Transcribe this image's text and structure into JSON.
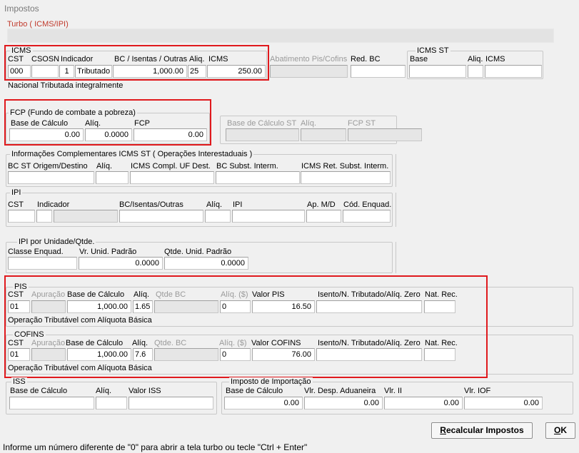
{
  "window": {
    "title": "Impostos"
  },
  "turbo": {
    "label": "Turbo ( ICMS/IPI)"
  },
  "icms": {
    "group_title": "ICMS",
    "labels": {
      "cst": "CST",
      "csosn": "CSOSN",
      "indicador": "Indicador",
      "bc": "BC / Isentas / Outras",
      "aliq": "Aliq.",
      "icms": "ICMS"
    },
    "values": {
      "cst": "000",
      "csosn": "",
      "ind_code": "1",
      "ind_text": "Tributado",
      "bc": "1,000.00",
      "aliq": "25",
      "icms": "250.00"
    },
    "description": "Nacional Tributada integralmente"
  },
  "abatimento": {
    "label": "Abatimento Pis/Cofins",
    "value": ""
  },
  "red_bc": {
    "label": "Red. BC",
    "value": ""
  },
  "icms_st": {
    "group_title": "ICMS ST",
    "labels": {
      "base": "Base",
      "aliq": "Aliq.",
      "icms": "ICMS"
    },
    "values": {
      "base": "",
      "aliq": "",
      "icms": ""
    }
  },
  "fcp": {
    "group_title": "FCP (Fundo de combate a pobreza)",
    "labels": {
      "base": "Base de Cálculo",
      "aliq": "Alíq.",
      "fcp": "FCP"
    },
    "values": {
      "base": "0.00",
      "aliq": "0.0000",
      "fcp": "0.00"
    }
  },
  "fcp_st": {
    "labels": {
      "base": "Base de Cálculo ST",
      "aliq": "Alíq.",
      "fcp": "FCP ST"
    },
    "values": {
      "base": "",
      "aliq": "",
      "fcp": ""
    }
  },
  "info_icms_st": {
    "group_title": "Informações Complementares ICMS ST ( Operações Interestaduais )",
    "labels": {
      "bc_origem": "BC ST Origem/Destino",
      "aliq": "Alíq.",
      "compl": "ICMS Compl. UF Dest.",
      "bc_subst": "BC  Subst. Interm.",
      "ret": "ICMS Ret. Subst. Interm."
    },
    "values": {
      "bc_origem": "",
      "aliq": "",
      "compl": "",
      "bc_subst": "",
      "ret": ""
    }
  },
  "ipi": {
    "group_title": "IPI",
    "labels": {
      "cst": "CST",
      "indicador": "Indicador",
      "bc": "BC/Isentas/Outras",
      "aliq": "Alíq.",
      "ipi": "IPI",
      "ap": "Ap. M/D",
      "cod": "Cód. Enquad."
    },
    "values": {
      "cst": "",
      "ind": "",
      "ind2": "",
      "bc": "",
      "aliq": "",
      "ipi": "",
      "ap": "",
      "cod": ""
    }
  },
  "ipi_unid": {
    "group_title": "IPI por Unidade/Qtde.",
    "labels": {
      "classe": "Classe Enquad.",
      "vr": "Vr. Unid. Padrão",
      "qtde": "Qtde. Unid. Padrão"
    },
    "values": {
      "classe": "",
      "vr": "0.0000",
      "qtde": "0.0000"
    }
  },
  "pis": {
    "group_title": "PIS",
    "labels": {
      "cst": "CST",
      "apuracao": "Apuração",
      "base": "Base de Cálculo",
      "aliq": "Alíq.",
      "qtde": "Qtde BC",
      "aliq_rs": "Alíq. ($)",
      "valor": "Valor PIS",
      "isento": "Isento/N. Tributado/Alíq. Zero",
      "nat": "Nat. Rec."
    },
    "values": {
      "cst": "01",
      "apuracao": "",
      "base": "1,000.00",
      "aliq": "1.65",
      "qtde": "",
      "aliq_rs": "0",
      "valor": "16.50",
      "isento": "",
      "nat": ""
    },
    "description": "Operação Tributável com Alíquota Básica"
  },
  "cofins": {
    "group_title": "COFINS",
    "labels": {
      "cst": "CST",
      "apuracao": "Apuração",
      "base": "Base de Cálculo",
      "aliq": "Alíq.",
      "qtde": "Qtde. BC",
      "aliq_rs": "Alíq. ($)",
      "valor": "Valor COFINS",
      "isento": "Isento/N. Tributado/Alíq. Zero",
      "nat": "Nat. Rec."
    },
    "values": {
      "cst": "01",
      "apuracao": "",
      "base": "1,000.00",
      "aliq": "7.6",
      "qtde": "",
      "aliq_rs": "0",
      "valor": "76.00",
      "isento": "",
      "nat": ""
    },
    "description": "Operação Tributável com Alíquota Básica"
  },
  "iss": {
    "group_title": "ISS",
    "labels": {
      "base": "Base de Cálculo",
      "aliq": "Alíq.",
      "valor": "Valor ISS"
    },
    "values": {
      "base": "",
      "aliq": "",
      "valor": ""
    }
  },
  "importacao": {
    "group_title": "Imposto de Importação",
    "labels": {
      "base": "Base de Cálculo",
      "desp": "Vlr. Desp. Aduaneira",
      "ii": "Vlr. II",
      "iof": "Vlr. IOF"
    },
    "values": {
      "base": "0.00",
      "desp": "0.00",
      "ii": "0.00",
      "iof": "0.00"
    }
  },
  "buttons": {
    "recalcular_first": "R",
    "recalcular_rest": "ecalcular Impostos",
    "ok_first": "O",
    "ok_rest": "K"
  },
  "status": {
    "text": "Informe um número diferente de \"0\" para abrir a tela turbo ou tecle \"Ctrl + Enter\""
  },
  "colors": {
    "highlight": "#e0191d",
    "turbo": "#c0392b"
  }
}
